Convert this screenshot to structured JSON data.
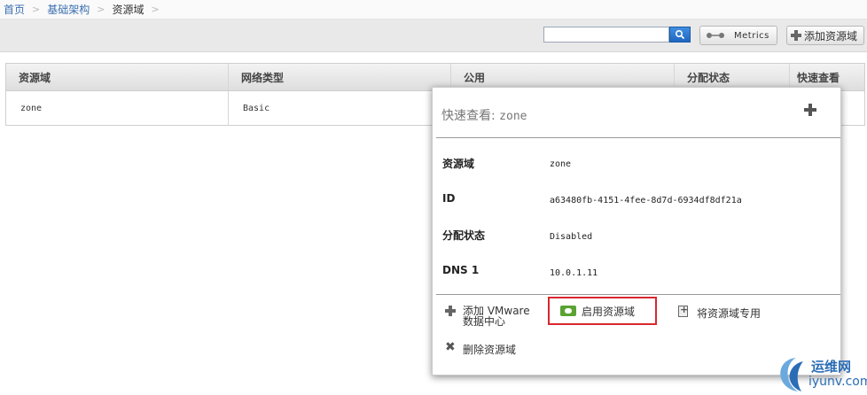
{
  "breadcrumb": [
    "首页",
    "基础架构",
    "资源域"
  ],
  "toolbar": {
    "search_value": "",
    "metrics_label": "Metrics",
    "add_zone_label": "添加资源域"
  },
  "table": {
    "columns": [
      "资源域",
      "网络类型",
      "公用",
      "分配状态",
      "快速查看"
    ],
    "rows": [
      [
        "zone",
        "Basic",
        "",
        "",
        ""
      ]
    ]
  },
  "quickview": {
    "title_prefix": "快速查看:",
    "title_name": "zone",
    "fields": [
      {
        "label": "资源域",
        "value": "zone"
      },
      {
        "label": "ID",
        "value": "a63480fb-4151-4fee-8d7d-6934df8df21a"
      },
      {
        "label": "分配状态",
        "value": "Disabled"
      },
      {
        "label": "DNS 1",
        "value": "10.0.1.11"
      }
    ],
    "actions": {
      "add_vmware_line1": "添加 VMware",
      "add_vmware_line2": "数据中心",
      "enable_zone": "启用资源域",
      "dedicate_zone": "将资源域专用",
      "delete_zone": "删除资源域"
    }
  },
  "watermark": {
    "cn": "运维网",
    "en": "iyunv.com"
  },
  "colors": {
    "breadcrumb_link": "#3a6fb0",
    "highlight_border": "#d9272e",
    "enable_icon": "#5aa333",
    "search_button": "#1f66c0"
  }
}
